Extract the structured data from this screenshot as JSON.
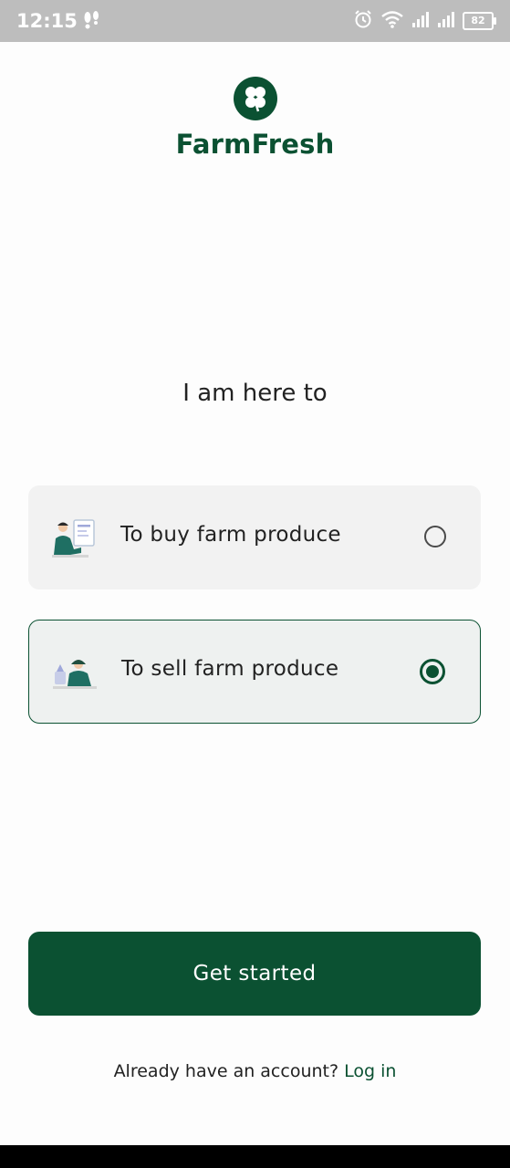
{
  "status_bar": {
    "time": "12:15",
    "battery": "82",
    "icons": [
      "footprint-icon",
      "alarm-icon",
      "wifi-icon",
      "signal-icon",
      "signal-icon",
      "battery-icon"
    ]
  },
  "brand": {
    "name": "FarmFresh",
    "logo_icon": "clover-logo-icon",
    "color": "#0b5132"
  },
  "prompt": "I am here to",
  "options": [
    {
      "label": "To buy farm produce",
      "illustration": "buyer-illustration",
      "selected": false
    },
    {
      "label": "To sell farm produce",
      "illustration": "seller-illustration",
      "selected": true
    }
  ],
  "cta": {
    "label": "Get started"
  },
  "footer": {
    "text": "Already have an account?",
    "link": "Log in"
  }
}
